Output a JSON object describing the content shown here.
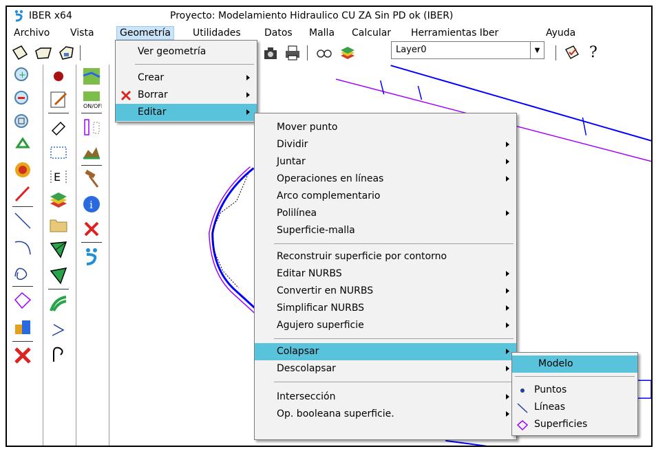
{
  "window": {
    "app_name": "IBER x64",
    "title": "Proyecto: Modelamiento Hidraulico CU ZA Sin PD ok (IBER)"
  },
  "menubar": {
    "items": [
      "Archivo",
      "Vista",
      "Geometría",
      "Utilidades",
      "Datos",
      "Malla",
      "Calcular",
      "Herramientas Iber",
      "Ayuda"
    ],
    "active": "Geometría"
  },
  "toolbar": {
    "layer_value": "Layer0",
    "help_glyph": "?"
  },
  "geometria_menu": {
    "items": [
      "Ver geometría",
      "Crear",
      "Borrar",
      "Editar"
    ],
    "highlighted": "Editar"
  },
  "editar_menu": {
    "items": [
      "Mover punto",
      "Dividir",
      "Juntar",
      "Operaciones en líneas",
      "Arco complementario",
      "Polilínea",
      "Superficie-malla",
      "Reconstruir superficie por contorno",
      "Editar NURBS",
      "Convertir en NURBS",
      "Simplificar NURBS",
      "Agujero superficie",
      "Colapsar",
      "Descolapsar",
      "Intersección",
      "Op. booleana superficie."
    ],
    "highlighted": "Colapsar"
  },
  "colapsar_menu": {
    "items": [
      "Modelo",
      "Puntos",
      "Líneas",
      "Superficies"
    ],
    "highlighted": "Modelo"
  },
  "colors": {
    "menu_highlight": "#59c3dc",
    "menubar_active": "#cce4f7",
    "geometry_blue": "#0000ff",
    "geometry_purple": "#a000ff"
  }
}
